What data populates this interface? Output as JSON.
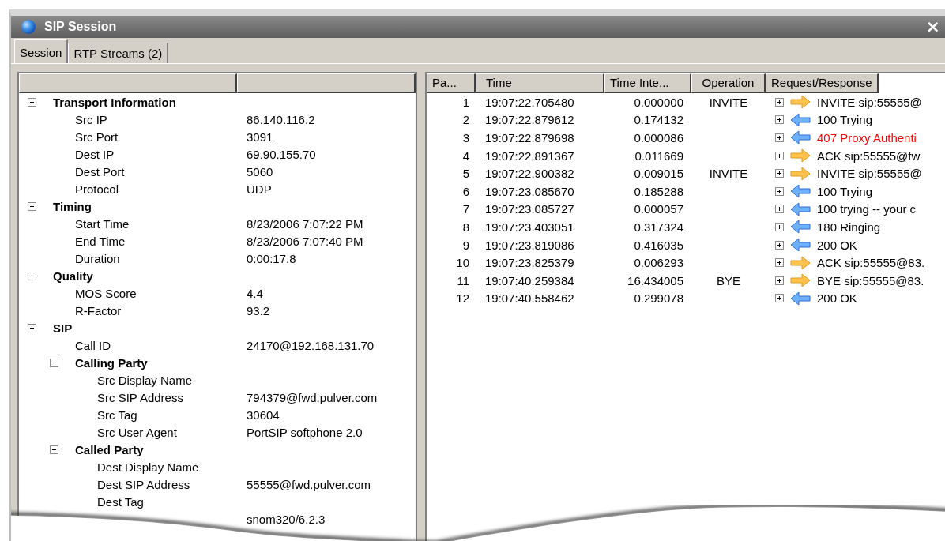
{
  "window": {
    "title": "SIP Session",
    "close": "×"
  },
  "tabs": [
    {
      "label": "Session",
      "selected": true
    },
    {
      "label": "RTP Streams (2)",
      "selected": false
    }
  ],
  "properties": {
    "items": [
      {
        "label": "Transport Information",
        "expanded": true,
        "children": [
          {
            "label": "Src IP",
            "value": "86.140.116.2"
          },
          {
            "label": "Src Port",
            "value": "3091"
          },
          {
            "label": "Dest IP",
            "value": "69.90.155.70"
          },
          {
            "label": "Dest Port",
            "value": "5060"
          },
          {
            "label": "Protocol",
            "value": "UDP"
          }
        ]
      },
      {
        "label": "Timing",
        "expanded": true,
        "children": [
          {
            "label": "Start Time",
            "value": "8/23/2006 7:07:22 PM"
          },
          {
            "label": "End Time",
            "value": "8/23/2006 7:07:40 PM"
          },
          {
            "label": "Duration",
            "value": "0:00:17.8"
          }
        ]
      },
      {
        "label": "Quality",
        "expanded": true,
        "children": [
          {
            "label": "MOS Score",
            "value": "4.4"
          },
          {
            "label": "R-Factor",
            "value": "93.2"
          }
        ]
      },
      {
        "label": "SIP",
        "expanded": true,
        "children": [
          {
            "label": "Call ID",
            "value": "24170@192.168.131.70"
          },
          {
            "label": "Calling Party",
            "expanded": true,
            "children": [
              {
                "label": "Src Display Name"
              },
              {
                "label": "Src SIP Address",
                "value": "794379@fwd.pulver.com"
              },
              {
                "label": "Src Tag",
                "value": "30604"
              },
              {
                "label": "Src User Agent",
                "value": "PortSIP softphone 2.0"
              }
            ]
          },
          {
            "label": "Called Party",
            "expanded": true,
            "children": [
              {
                "label": "Dest Display Name"
              },
              {
                "label": "Dest SIP Address",
                "value": "55555@fwd.pulver.com"
              },
              {
                "label": "Dest Tag"
              },
              {
                "value": "snom320/6.2.3"
              }
            ]
          }
        ]
      }
    ]
  },
  "packets": {
    "columns": [
      "Pa...",
      "Time",
      "Time Inte...",
      "Operation",
      "Request/Response"
    ],
    "rows": [
      {
        "packet": "1",
        "time": "19:07:22.705480",
        "interval": "0.000000",
        "operation": "INVITE",
        "kind": "outgoing",
        "expanded": false,
        "message": "INVITE sip:55555@",
        "color": "#000000"
      },
      {
        "packet": "2",
        "time": "19:07:22.879612",
        "interval": "0.174132",
        "kind": "incoming",
        "expanded": false,
        "message": "100 Trying",
        "color": "#000000"
      },
      {
        "packet": "3",
        "time": "19:07:22.879698",
        "interval": "0.000086",
        "kind": "incoming",
        "expanded": false,
        "message": "407 Proxy Authenti",
        "color": "#ff0000"
      },
      {
        "packet": "4",
        "time": "19:07:22.891367",
        "interval": "0.011669",
        "kind": "outgoing",
        "expanded": false,
        "message": "ACK sip:55555@fw",
        "color": "#000000"
      },
      {
        "packet": "5",
        "time": "19:07:22.900382",
        "interval": "0.009015",
        "operation": "INVITE",
        "kind": "outgoing",
        "expanded": false,
        "message": "INVITE sip:55555@",
        "color": "#000000"
      },
      {
        "packet": "6",
        "time": "19:07:23.085670",
        "interval": "0.185288",
        "kind": "incoming",
        "expanded": false,
        "message": "100 Trying",
        "color": "#000000"
      },
      {
        "packet": "7",
        "time": "19:07:23.085727",
        "interval": "0.000057",
        "kind": "incoming",
        "expanded": false,
        "message": "100 trying -- your c",
        "color": "#000000"
      },
      {
        "packet": "8",
        "time": "19:07:23.403051",
        "interval": "0.317324",
        "kind": "incoming",
        "expanded": false,
        "message": "180 Ringing",
        "color": "#000000"
      },
      {
        "packet": "9",
        "time": "19:07:23.819086",
        "interval": "0.416035",
        "kind": "incoming",
        "expanded": false,
        "message": "200 OK",
        "color": "#000000"
      },
      {
        "packet": "10",
        "time": "19:07:23.825379",
        "interval": "0.006293",
        "kind": "outgoing",
        "expanded": false,
        "message": "ACK sip:55555@83.",
        "color": "#000000"
      },
      {
        "packet": "11",
        "time": "19:07:40.259384",
        "interval": "16.434005",
        "operation": "BYE",
        "kind": "outgoing",
        "expanded": false,
        "message": "BYE sip:55555@83.",
        "color": "#000000"
      },
      {
        "packet": "12",
        "time": "19:07:40.558462",
        "interval": "0.299078",
        "kind": "incoming",
        "expanded": false,
        "message": "200 OK",
        "color": "#000000"
      }
    ]
  }
}
